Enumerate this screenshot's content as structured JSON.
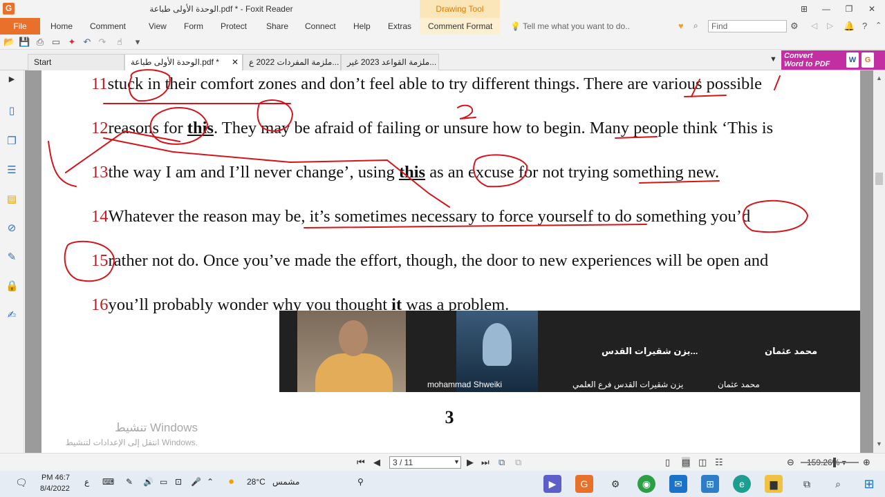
{
  "titlebar": {
    "title": "الوحدة الأولى طباعة.pdf * - Foxit Reader",
    "drawing_tool": "Drawing Tool"
  },
  "menu": {
    "file": "File",
    "items": [
      "Home",
      "Comment",
      "View",
      "Form",
      "Protect",
      "Share",
      "Connect",
      "Help",
      "Extras",
      "Comment Format"
    ],
    "tell_me": "Tell me what you want to do..",
    "find_placeholder": "Find"
  },
  "tabs": {
    "start": "Start",
    "items": [
      "الوحدة الأولى طباعة.pdf *",
      "ملزمة المفردات 2022 ع...",
      "ملزمة القواعد 2023 غير..."
    ]
  },
  "convert": {
    "line1": "Convert",
    "line2": "Word to PDF"
  },
  "document": {
    "lines": [
      {
        "num": "11",
        "text": "stuck in their comfort zones and don’t feel able to try different things. There are various possible"
      },
      {
        "num": "12",
        "pre": "reasons for ",
        "bold": "this",
        "post": ". They may be afraid of failing or unsure how to begin. Many people think ‘This is"
      },
      {
        "num": "13",
        "pre": "the way I am and I’ll never change’, using ",
        "bold": "this",
        "post": " as an excuse for not trying something new."
      },
      {
        "num": "14",
        "text": "Whatever the reason may be, it’s sometimes necessary to force yourself to do something you’d"
      },
      {
        "num": "15",
        "text": "rather not do. Once you’ve made the effort, though, the door to new experiences will be open and"
      },
      {
        "num": "16",
        "pre": "you’ll probably wonder why you thought ",
        "bold": "it",
        "post": " was a problem."
      }
    ],
    "page_number": "3"
  },
  "activation": {
    "title": "تنشيط Windows",
    "subtitle": "انتقل إلى الإعدادات لتنشيط Windows."
  },
  "video": {
    "participant1": "mohammad Shweiki",
    "participant2_short": "يزن شقيرات القدس...",
    "participant2_full": "يزن شقيرات القدس فرع العلمي",
    "participant3_short": "محمد عثمان",
    "participant3_full": "محمد عثمان"
  },
  "statusbar": {
    "page": "3 / 11",
    "zoom": "159.26%"
  },
  "taskbar": {
    "time": "PM 46:7",
    "date": "8/4/2022",
    "lang": "ع",
    "temp": "28°C",
    "weather": "مشمس"
  },
  "colors": {
    "accent": "#e8702a",
    "annotation": "#d4141a",
    "convert": "#c22fa3"
  }
}
